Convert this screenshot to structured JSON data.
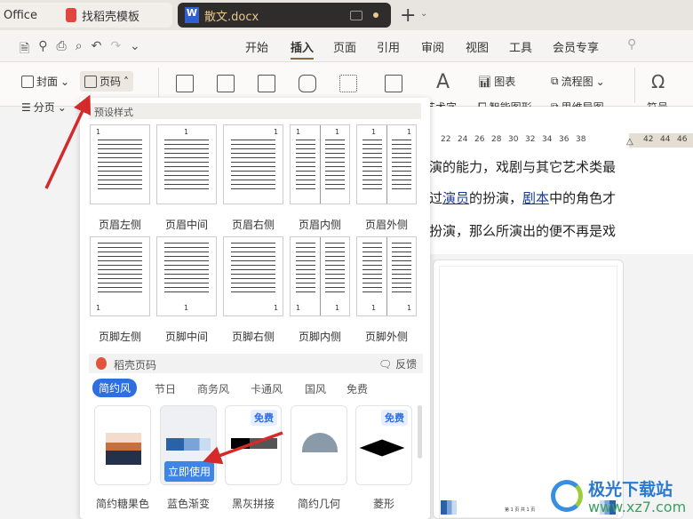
{
  "tabs": [
    {
      "label": "Office"
    },
    {
      "label": "找稻壳模板"
    },
    {
      "label": "散文.docx"
    }
  ],
  "menu": [
    "开始",
    "插入",
    "页面",
    "引用",
    "审阅",
    "视图",
    "工具",
    "会员专享"
  ],
  "active_menu": "插入",
  "ribbon": {
    "cover": "封面",
    "page_num": "页码",
    "page_break": "分页",
    "chart": "图表",
    "flowchart": "流程图",
    "art_text": "艺术字",
    "smart_shape": "智能图形",
    "mindmap": "思维导图",
    "symbol": "符号"
  },
  "panel": {
    "preset_title": "预设样式",
    "presets_header": [
      "页眉左侧",
      "页眉中间",
      "页眉右侧",
      "页眉内侧",
      "页眉外侧"
    ],
    "presets_footer": [
      "页脚左侧",
      "页脚中间",
      "页脚右侧",
      "页脚内侧",
      "页脚外侧"
    ],
    "thumb_num": "1",
    "docer_title": "稻壳页码",
    "feedback": "反馈",
    "categories": [
      "简约风",
      "节日",
      "商务风",
      "卡通风",
      "国风",
      "免费"
    ],
    "active_category": "简约风",
    "templates": [
      {
        "name": "简约糖果色",
        "free": false
      },
      {
        "name": "蓝色渐变",
        "free": false
      },
      {
        "name": "黑灰拼接",
        "free": true
      },
      {
        "name": "简约几何",
        "free": false
      },
      {
        "name": "菱形",
        "free": true
      }
    ],
    "free_badge": "免费",
    "use_now": "立即使用"
  },
  "ruler": [
    "22",
    "24",
    "26",
    "28",
    "30",
    "32",
    "34",
    "36",
    "38",
    "42",
    "44",
    "46"
  ],
  "doc_lines": {
    "l1": "演的能力，戏剧与其它艺术类最",
    "l2a": "过",
    "l2link1": "演员",
    "l2b": "的扮演，",
    "l2link2": "剧本",
    "l2c": "中的角色才",
    "l3": "扮演，那么所演出的便不再是戏"
  },
  "preview_footer": "第 1 页 共 1 页",
  "watermark": {
    "name": "极光下载站",
    "url": "www.xz7.com"
  },
  "colors": {
    "accent": "#2d6ee0",
    "active_tab": "#2f2d2b",
    "arrow": "#d42a2a",
    "menu_underline": "#8a6a3a"
  }
}
